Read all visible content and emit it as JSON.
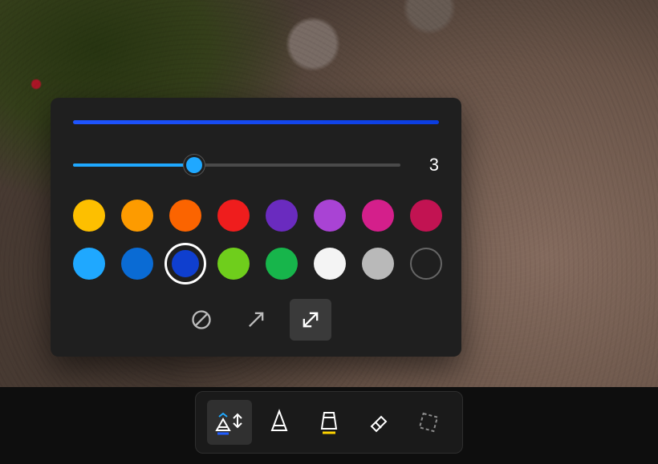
{
  "slider": {
    "value": "3",
    "percent": 37
  },
  "preview_color": "#1648ff",
  "arrow_styles": {
    "selected_index": 2
  },
  "colors": {
    "selected_index": 10,
    "palette": [
      "#fdbf00",
      "#fd9b00",
      "#fb6400",
      "#ef1d1d",
      "#6a2bbf",
      "#a943d4",
      "#d41f8b",
      "#c21352",
      "#1fa8ff",
      "#0a6bd4",
      "#0f3fcf",
      "#6fce1c",
      "#17b54b",
      "#f4f4f4",
      "#b9b9b9",
      "hollow"
    ]
  },
  "toolbar": {
    "selected_index": 0,
    "items": [
      {
        "name": "pen-arrow-tool",
        "underline": "#1f5cff"
      },
      {
        "name": "pen-tool",
        "underline": null
      },
      {
        "name": "highlighter-tool",
        "underline": "#ffd400"
      },
      {
        "name": "eraser-tool",
        "underline": null
      },
      {
        "name": "crop-tool",
        "underline": null
      }
    ]
  }
}
